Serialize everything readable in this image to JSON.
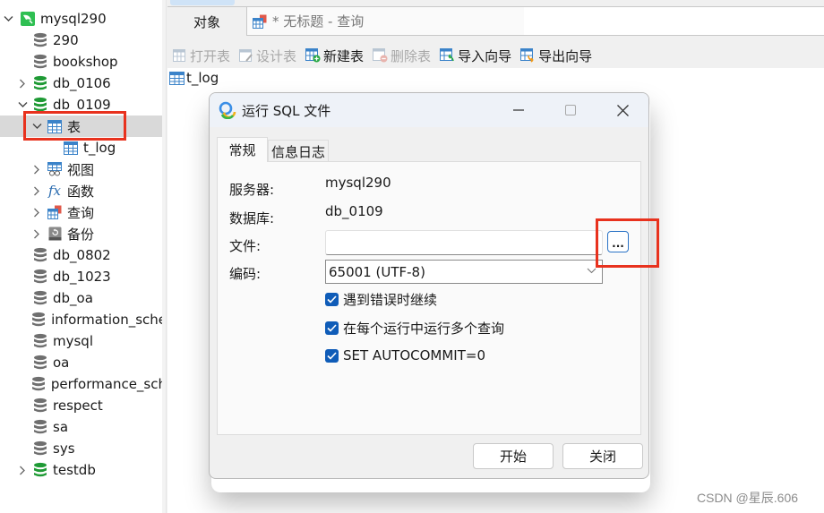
{
  "sidebar": {
    "connection": {
      "label": "mysql290",
      "expanded": true
    },
    "databases": [
      {
        "label": "290",
        "open": false,
        "expandable": false
      },
      {
        "label": "bookshop",
        "open": false,
        "expandable": false
      },
      {
        "label": "db_0106",
        "open": true,
        "expandable": true,
        "expanded": false
      },
      {
        "label": "db_0109",
        "open": true,
        "expandable": true,
        "expanded": true
      },
      {
        "label": "db_0802",
        "open": false,
        "expandable": false
      },
      {
        "label": "db_1023",
        "open": false,
        "expandable": false
      },
      {
        "label": "db_oa",
        "open": false,
        "expandable": false
      },
      {
        "label": "information_sche",
        "open": false,
        "expandable": false
      },
      {
        "label": "mysql",
        "open": false,
        "expandable": false
      },
      {
        "label": "oa",
        "open": false,
        "expandable": false
      },
      {
        "label": "performance_sch",
        "open": false,
        "expandable": false
      },
      {
        "label": "respect",
        "open": false,
        "expandable": false
      },
      {
        "label": "sa",
        "open": false,
        "expandable": false
      },
      {
        "label": "sys",
        "open": false,
        "expandable": false
      },
      {
        "label": "testdb",
        "open": true,
        "expandable": true,
        "expanded": false
      }
    ],
    "db_0109_children": [
      {
        "label": "表",
        "icon": "table-icon",
        "expanded": true,
        "selected": true
      },
      {
        "label": "t_log",
        "icon": "table-icon",
        "child": true
      },
      {
        "label": "视图",
        "icon": "view-icon"
      },
      {
        "label": "函数",
        "icon": "function-icon"
      },
      {
        "label": "查询",
        "icon": "query-icon"
      },
      {
        "label": "备份",
        "icon": "backup-icon"
      }
    ]
  },
  "main": {
    "tabs": [
      {
        "label": "对象",
        "active": true
      },
      {
        "label": "* 无标题 - 查询",
        "active": false
      }
    ],
    "toolbar": [
      {
        "label": "打开表",
        "enabled": false,
        "icon": "open-table-icon"
      },
      {
        "label": "设计表",
        "enabled": false,
        "icon": "design-table-icon"
      },
      {
        "label": "新建表",
        "enabled": true,
        "icon": "new-table-icon"
      },
      {
        "label": "删除表",
        "enabled": false,
        "icon": "delete-table-icon"
      },
      {
        "label": "导入向导",
        "enabled": true,
        "icon": "import-wizard-icon"
      },
      {
        "label": "导出向导",
        "enabled": true,
        "icon": "export-wizard-icon"
      }
    ],
    "objects": [
      {
        "label": "t_log"
      }
    ]
  },
  "dialog": {
    "title": "运行 SQL 文件",
    "tabs": [
      {
        "label": "常规",
        "active": true
      },
      {
        "label": "信息日志",
        "active": false
      }
    ],
    "fields": {
      "server_label": "服务器:",
      "server_value": "mysql290",
      "database_label": "数据库:",
      "database_value": "db_0109",
      "file_label": "文件:",
      "file_value": "",
      "browse_label": "...",
      "encoding_label": "编码:",
      "encoding_value": "65001 (UTF-8)"
    },
    "checkboxes": [
      {
        "label": "遇到错误时继续",
        "checked": true
      },
      {
        "label": "在每个运行中运行多个查询",
        "checked": true
      },
      {
        "label": "SET AUTOCOMMIT=0",
        "checked": true
      }
    ],
    "buttons": {
      "start": "开始",
      "close": "关闭"
    }
  },
  "colors": {
    "highlight_box": "#e8321e",
    "checkbox": "#0f5cb8",
    "open_db": "#1f9a35",
    "closed_db": "#6f6f6f"
  },
  "watermark": "CSDN @星辰.606"
}
